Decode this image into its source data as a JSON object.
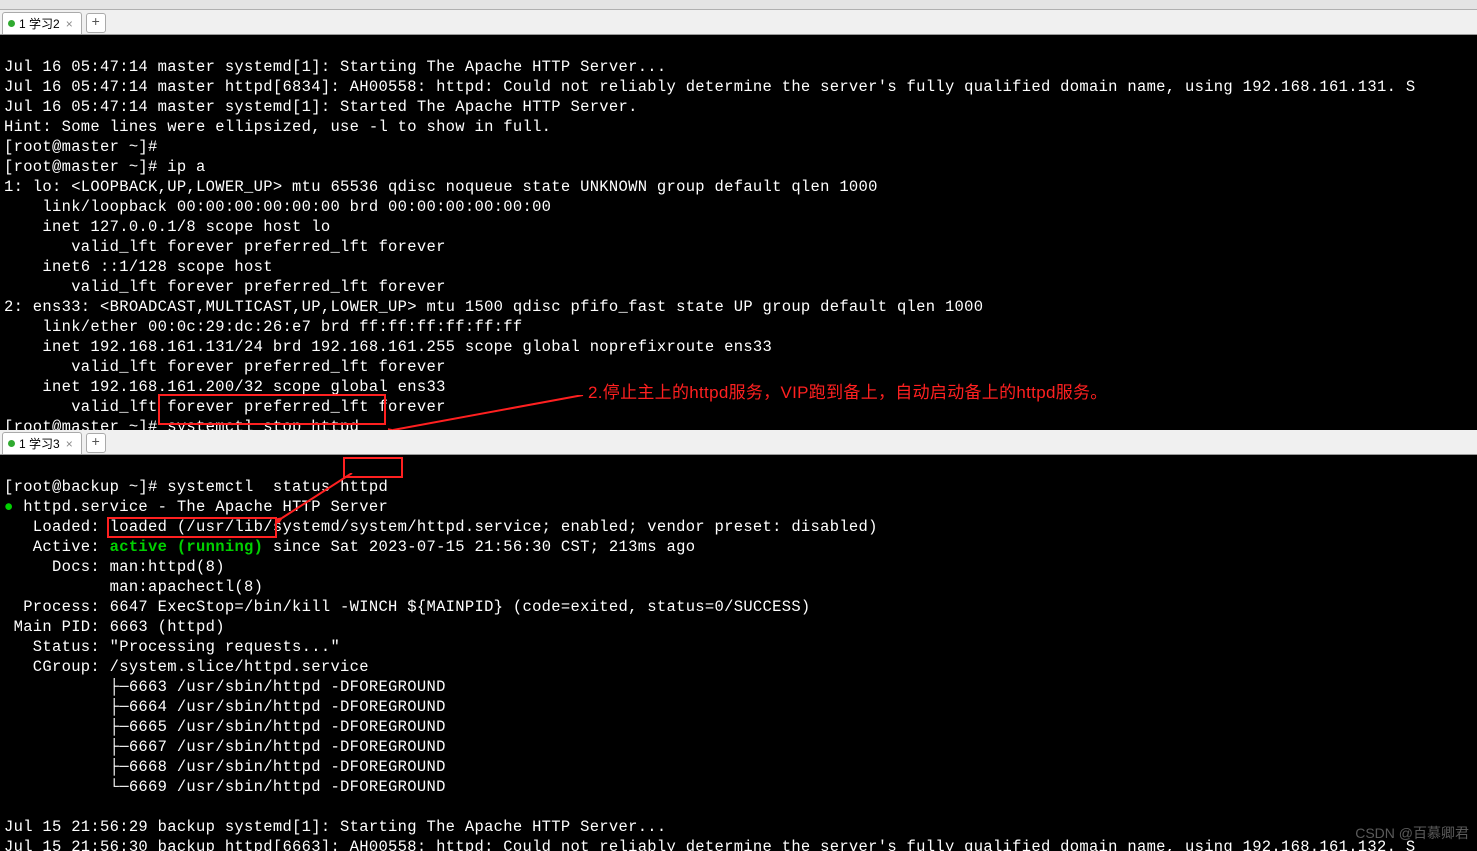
{
  "topbar": {
    "title_hint": ""
  },
  "tabs1": {
    "tab_label": "1 学习2",
    "add": "+"
  },
  "tabs2": {
    "tab_label": "1 学习3",
    "add": "+"
  },
  "term1": {
    "l1": "Jul 16 05:47:14 master systemd[1]: Starting The Apache HTTP Server...",
    "l2": "Jul 16 05:47:14 master httpd[6834]: AH00558: httpd: Could not reliably determine the server's fully qualified domain name, using 192.168.161.131. S",
    "l3": "Jul 16 05:47:14 master systemd[1]: Started The Apache HTTP Server.",
    "l4": "Hint: Some lines were ellipsized, use -l to show in full.",
    "l5": "[root@master ~]# ",
    "l6": "[root@master ~]# ip a",
    "l7": "1: lo: <LOOPBACK,UP,LOWER_UP> mtu 65536 qdisc noqueue state UNKNOWN group default qlen 1000",
    "l8": "    link/loopback 00:00:00:00:00:00 brd 00:00:00:00:00:00",
    "l9": "    inet 127.0.0.1/8 scope host lo",
    "l10": "       valid_lft forever preferred_lft forever",
    "l11": "    inet6 ::1/128 scope host ",
    "l12": "       valid_lft forever preferred_lft forever",
    "l13": "2: ens33: <BROADCAST,MULTICAST,UP,LOWER_UP> mtu 1500 qdisc pfifo_fast state UP group default qlen 1000",
    "l14": "    link/ether 00:0c:29:dc:26:e7 brd ff:ff:ff:ff:ff:ff",
    "l15": "    inet 192.168.161.131/24 brd 192.168.161.255 scope global noprefixroute ens33",
    "l16": "       valid_lft forever preferred_lft forever",
    "l17": "    inet 192.168.161.200/32 scope global ens33",
    "l18": "       valid_lft forever preferred_lft forever",
    "l19_prefix": "[root@master ~]# ",
    "l19_cmd": "systemctl stop httpd"
  },
  "annotation": {
    "text": "2.停止主上的httpd服务，VIP跑到备上，自动启动备上的httpd服务。"
  },
  "term2": {
    "l1_prefix": "[root@backup ~]# systemctl  status ",
    "l1_hl": "httpd",
    "l2_a": "● ",
    "l2_b": "httpd.service - The Apache HTTP Server",
    "l3": "   Loaded: loaded (/usr/lib/systemd/system/httpd.service; enabled; vendor preset: disabled)",
    "l4_a": "   Active: ",
    "l4_hl": "active (running)",
    "l4_b": " since Sat 2023-07-15 21:56:30 CST; 213ms ago",
    "l5": "     Docs: man:httpd(8)",
    "l6": "           man:apachectl(8)",
    "l7": "  Process: 6647 ExecStop=/bin/kill -WINCH ${MAINPID} (code=exited, status=0/SUCCESS)",
    "l8": " Main PID: 6663 (httpd)",
    "l9": "   Status: \"Processing requests...\"",
    "l10": "   CGroup: /system.slice/httpd.service",
    "l11": "           ├─6663 /usr/sbin/httpd -DFOREGROUND",
    "l12": "           ├─6664 /usr/sbin/httpd -DFOREGROUND",
    "l13": "           ├─6665 /usr/sbin/httpd -DFOREGROUND",
    "l14": "           ├─6667 /usr/sbin/httpd -DFOREGROUND",
    "l15": "           ├─6668 /usr/sbin/httpd -DFOREGROUND",
    "l16": "           └─6669 /usr/sbin/httpd -DFOREGROUND",
    "l17": "",
    "l18": "Jul 15 21:56:29 backup systemd[1]: Starting The Apache HTTP Server...",
    "l19": "Jul 15 21:56:30 backup httpd[6663]: AH00558: httpd: Could not reliably determine the server's fully qualified domain name, using 192.168.161.132. S"
  },
  "watermark": "CSDN @百慕卿君"
}
